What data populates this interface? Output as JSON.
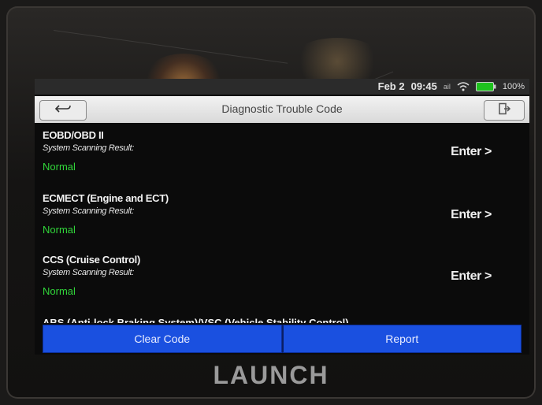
{
  "statusbar": {
    "date": "Feb 2",
    "time": "09:45",
    "signal": "ail",
    "battery": "100%"
  },
  "titlebar": {
    "title": "Diagnostic Trouble Code",
    "back_icon": "back-arrow-icon",
    "exit_icon": "exit-icon"
  },
  "systems": [
    {
      "name": "EOBD/OBD II",
      "label": "System Scanning Result:",
      "status": "Normal",
      "action": "Enter >"
    },
    {
      "name": "ECMECT (Engine and ECT)",
      "label": "System Scanning Result:",
      "status": "Normal",
      "action": "Enter >"
    },
    {
      "name": "CCS (Cruise Control)",
      "label": "System Scanning Result:",
      "status": "Normal",
      "action": "Enter >"
    }
  ],
  "partial_item": "ABS (Anti-lock Braking System)/VSC (Vehicle Stability Control)",
  "bottom": {
    "clear_label": "Clear Code",
    "report_label": "Report"
  },
  "brand": "LAUNCH",
  "colors": {
    "accent_blue": "#1a50e0",
    "normal_green": "#31d63a"
  }
}
